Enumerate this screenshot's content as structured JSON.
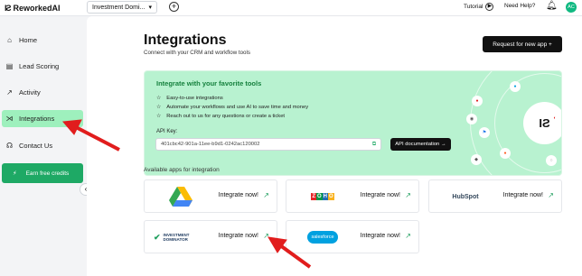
{
  "app": {
    "name": "ReworkedAI"
  },
  "topbar": {
    "workspace": "Investment Domi...",
    "tutorial_label": "Tutorial",
    "help_label": "Need Help?",
    "avatar_initials": "AC"
  },
  "sidebar": {
    "items": [
      {
        "label": "Home",
        "icon": "home-icon"
      },
      {
        "label": "Lead Scoring",
        "icon": "chart-icon"
      },
      {
        "label": "Activity",
        "icon": "activity-icon"
      },
      {
        "label": "Integrations",
        "icon": "integrations-icon",
        "active": true
      },
      {
        "label": "Contact Us",
        "icon": "headset-icon"
      }
    ],
    "earn_label": "Earn free credits"
  },
  "page": {
    "title": "Integrations",
    "subtitle": "Connect with your CRM and workflow tools",
    "request_button": "Request for new app +"
  },
  "banner": {
    "title": "Integrate with your favorite tools",
    "bullets": [
      "Easy-to-use integrations",
      "Automate your workflows and use AI to save time and money",
      "Reach out to us for any questions or create a ticket"
    ],
    "api_key_label": "API Key:",
    "api_key_value": "401cbc42-901a-11ee-b9d1-0242ac120002",
    "api_doc_button": "API documentation →"
  },
  "apps": {
    "section_label": "Available apps for integration",
    "integrate_label": "Integrate now!",
    "cards": [
      {
        "name": "Google Drive",
        "logo_text": ""
      },
      {
        "name": "Zoho",
        "logo_text": "ZOHO"
      },
      {
        "name": "HubSpot",
        "logo_text": "HubSpot"
      },
      {
        "name": "Investment Dominator",
        "logo_text": "INVESTMENT DOMINATOR"
      },
      {
        "name": "Salesforce",
        "logo_text": "salesforce"
      }
    ]
  },
  "colors": {
    "accent": "#1ea965",
    "active_nav": "#9ef0bd",
    "banner": "#b8f2d0",
    "arrow": "#e11d1d"
  }
}
